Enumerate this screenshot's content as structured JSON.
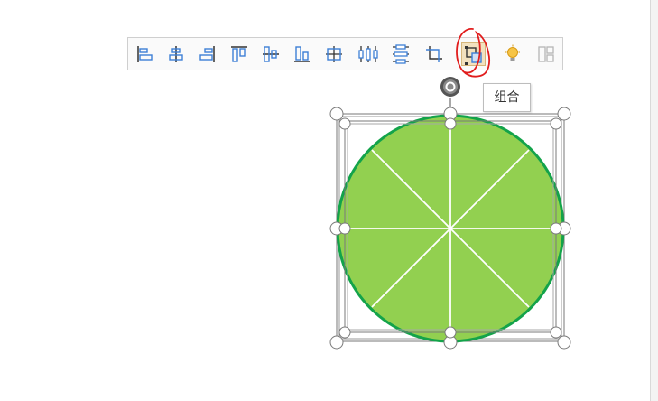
{
  "toolbar": {
    "buttons": [
      {
        "name": "align-left-icon"
      },
      {
        "name": "align-center-icon"
      },
      {
        "name": "align-right-icon"
      },
      {
        "name": "align-top-icon"
      },
      {
        "name": "align-middle-icon"
      },
      {
        "name": "align-bottom-icon"
      },
      {
        "name": "align-center-both-icon"
      },
      {
        "name": "distribute-horizontal-icon"
      },
      {
        "name": "distribute-vertical-icon"
      },
      {
        "name": "crop-icon"
      },
      {
        "name": "group-icon",
        "active": true
      },
      {
        "name": "lightbulb-icon"
      },
      {
        "name": "ungroup-icon"
      }
    ]
  },
  "tooltip": {
    "text": "组合"
  },
  "colors": {
    "accent_blue": "#3d7fd6",
    "circle_fill": "#92d050",
    "circle_stroke": "#13a34a",
    "annotation_red": "#e11d1d",
    "active_bg": "#f2e1bf"
  }
}
